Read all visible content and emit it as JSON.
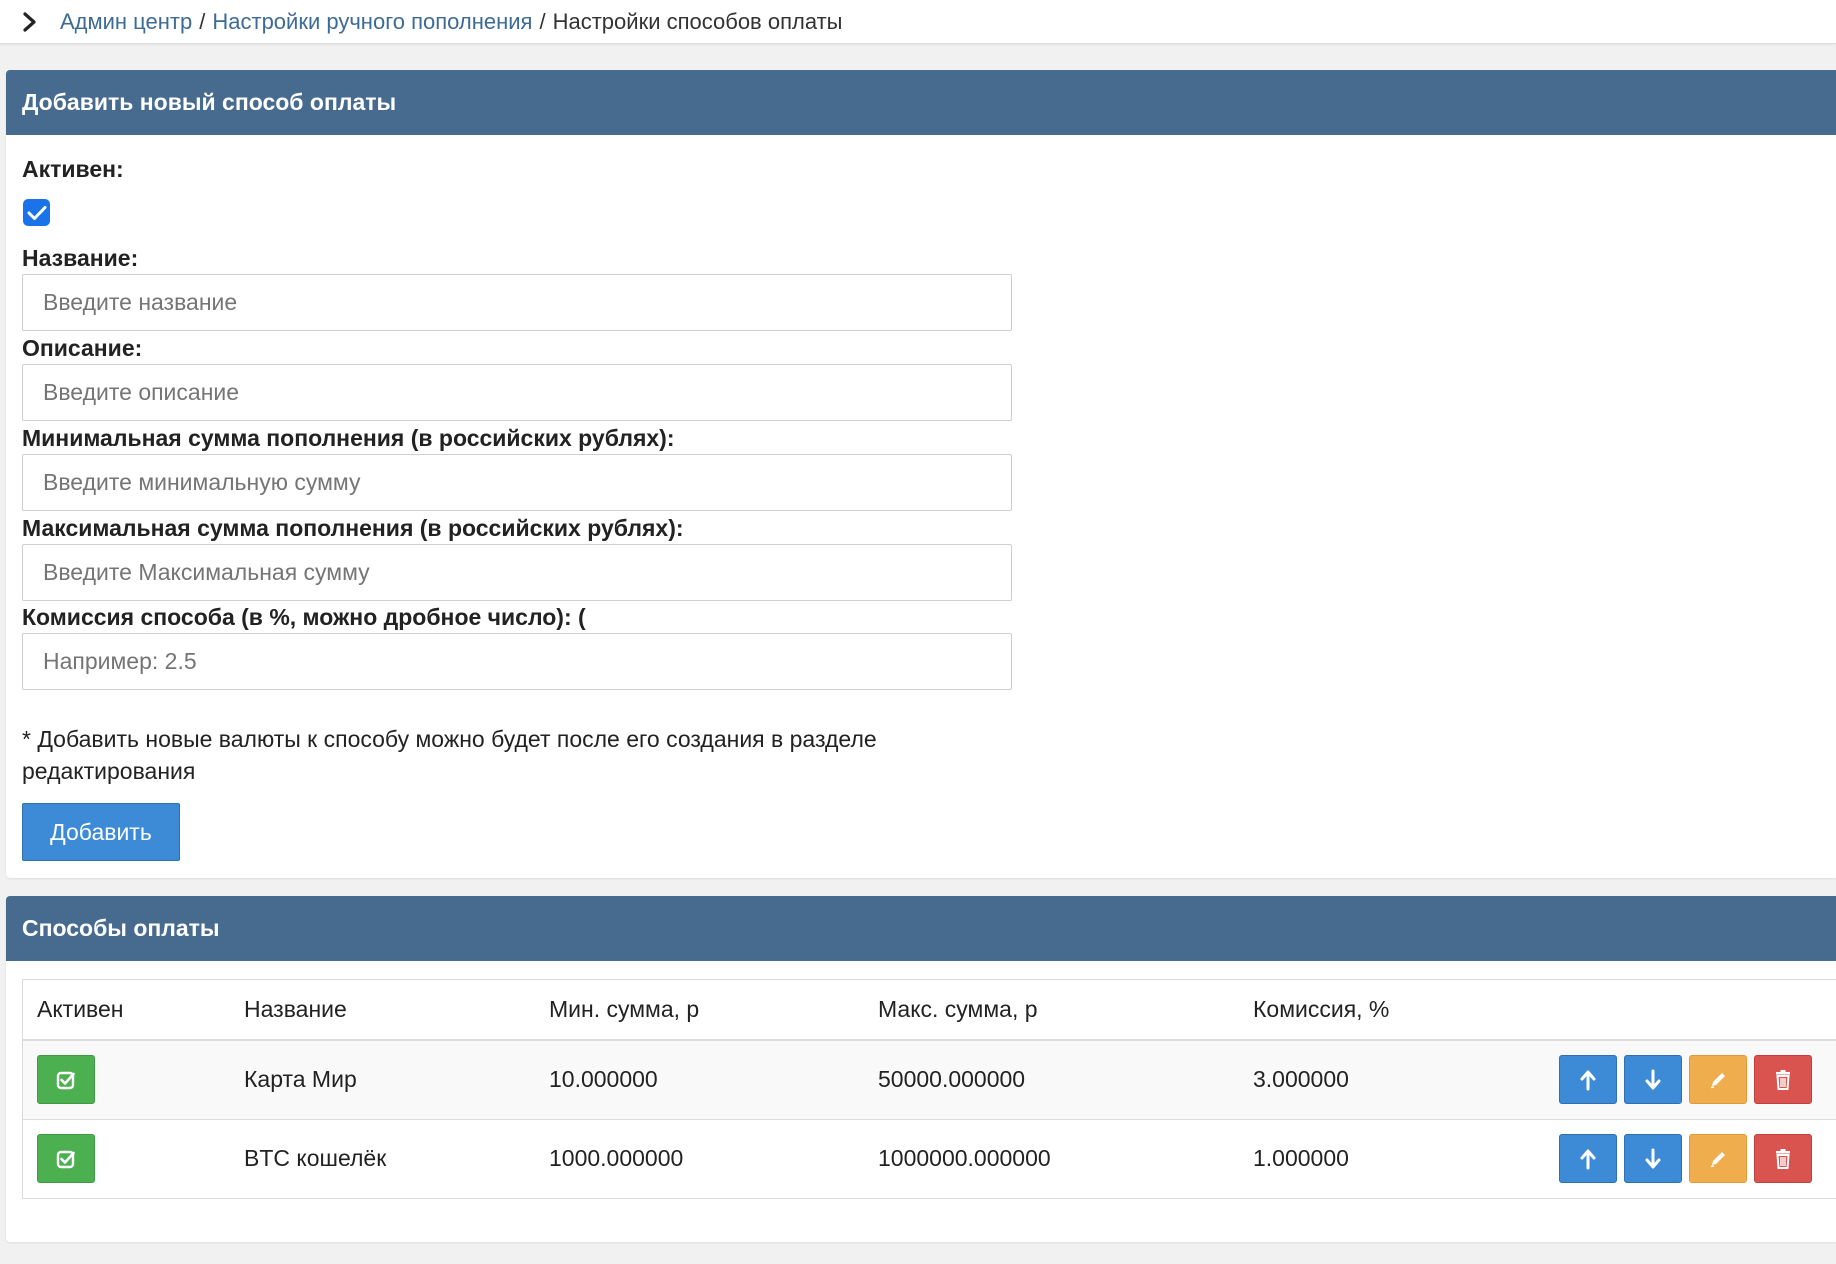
{
  "breadcrumb": {
    "items": [
      {
        "label": "Админ центр"
      },
      {
        "label": "Настройки ручного пополнения"
      }
    ],
    "separator": "/",
    "current": "Настройки способов оплаты"
  },
  "add_panel": {
    "title": "Добавить новый способ оплаты",
    "active_label": "Активен:",
    "active_checked": true,
    "name_label": "Название:",
    "name_placeholder": "Введите название",
    "description_label": "Описание:",
    "description_placeholder": "Введите описание",
    "min_label": "Минимальная сумма пополнения (в российских рублях):",
    "min_placeholder": "Введите минимальную сумму",
    "max_label": "Максимальная сумма пополнения (в российских рублях):",
    "max_placeholder": "Введите Максимальная сумму",
    "commission_label": "Комиссия способа (в %, можно дробное число): (",
    "commission_placeholder": "Например: 2.5",
    "note": "* Добавить новые валюты к способу можно будет после его создания в разделе редактирования",
    "submit_label": "Добавить"
  },
  "list_panel": {
    "title": "Способы оплаты",
    "columns": {
      "active": "Активен",
      "name": "Название",
      "min": "Мин. сумма, р",
      "max": "Макс. сумма, р",
      "commission": "Комиссия, %"
    },
    "rows": [
      {
        "active": true,
        "name": "Карта Мир",
        "min": "10.000000",
        "max": "50000.000000",
        "commission": "3.000000"
      },
      {
        "active": true,
        "name": "BTC кошелёк",
        "min": "1000.000000",
        "max": "1000000.000000",
        "commission": "1.000000"
      }
    ]
  },
  "colors": {
    "panel_header": "#476b8e",
    "link": "#3d6b96",
    "primary": "#3d8bd6",
    "success": "#4cb050",
    "warning": "#f0ad4e",
    "danger": "#d9534f"
  },
  "icons": {
    "breadcrumb": "chevron-right-icon",
    "row_active": "check-square-icon",
    "move_up": "arrow-up-icon",
    "move_down": "arrow-down-icon",
    "edit": "pencil-icon",
    "delete": "trash-icon"
  }
}
